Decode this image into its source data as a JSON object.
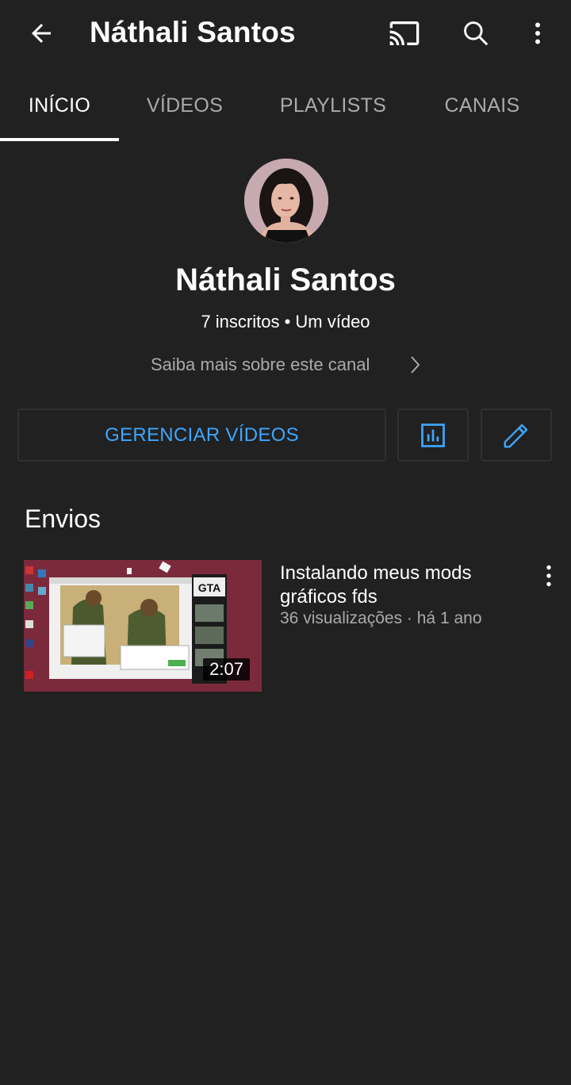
{
  "header": {
    "title": "Náthali Santos",
    "icons": [
      "back-arrow-icon",
      "cast-icon",
      "search-icon",
      "more-vert-icon"
    ]
  },
  "tabs": [
    {
      "label": "INÍCIO",
      "active": true
    },
    {
      "label": "VÍDEOS",
      "active": false
    },
    {
      "label": "PLAYLISTS",
      "active": false
    },
    {
      "label": "CANAIS",
      "active": false
    }
  ],
  "channel": {
    "name": "Náthali Santos",
    "stats": "7 inscritos • Um vídeo",
    "about_link": "Saiba mais sobre este canal"
  },
  "actions": {
    "manage_label": "GERENCIAR VÍDEOS",
    "stats_icon": "analytics-icon",
    "edit_icon": "pencil-icon"
  },
  "uploads": {
    "title": "Envios",
    "videos": [
      {
        "title": "Instalando meus mods gráficos fds",
        "meta": "36 visualizações · há 1 ano",
        "duration": "2:07"
      }
    ]
  },
  "colors": {
    "background": "#212121",
    "accent": "#3ea6ff",
    "secondary_text": "#aaaaaa",
    "border": "#303030"
  }
}
